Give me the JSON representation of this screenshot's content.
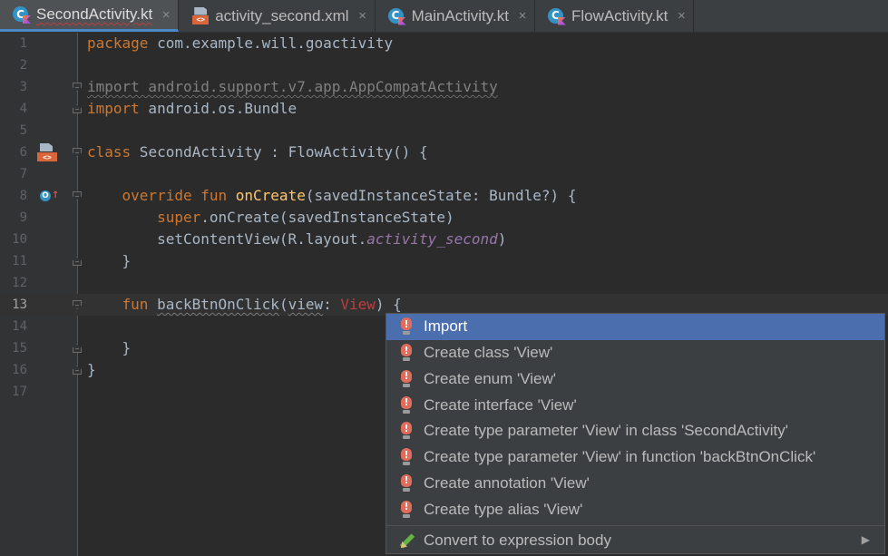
{
  "tabs": [
    {
      "label": "SecondActivity.kt",
      "icon": "kotlin-class-icon",
      "active": true
    },
    {
      "label": "activity_second.xml",
      "icon": "xml-layout-icon",
      "active": false
    },
    {
      "label": "MainActivity.kt",
      "icon": "kotlin-class-icon",
      "active": false
    },
    {
      "label": "FlowActivity.kt",
      "icon": "kotlin-class-icon",
      "active": false
    }
  ],
  "tab_close_glyph": "×",
  "line_numbers": [
    "1",
    "2",
    "3",
    "4",
    "5",
    "6",
    "7",
    "8",
    "9",
    "10",
    "11",
    "12",
    "13",
    "14",
    "15",
    "16",
    "17"
  ],
  "code": {
    "l1_kw": "package",
    "l1_rest": " com.example.will.goactivity",
    "l3": "import android.support.v7.app.AppCompatActivity",
    "l4_kw": "import",
    "l4_rest": " android.os.Bundle",
    "l6_kw": "class",
    "l6_rest": " SecondActivity : FlowActivity() {",
    "l8_kw": "override fun",
    "l8_fn": "onCreate",
    "l8_rest": "(savedInstanceState: Bundle?) {",
    "l9_kw": "super",
    "l9_rest": ".onCreate(savedInstanceState)",
    "l10_a": "setContentView(R.layout.",
    "l10_field": "activity_second",
    "l10_b": ")",
    "l11": "}",
    "l13_kw": "fun",
    "l13_fn": "backBtnOnClick",
    "l13_p1": "(",
    "l13_param": "view",
    "l13_p2": ": ",
    "l13_type": "View",
    "l13_p3": ") {",
    "l15": "}",
    "l16": "}"
  },
  "gutter_icons": {
    "xml_badge": "<>",
    "override_letter": "O",
    "override_arrow": "↑"
  },
  "popup": {
    "items": [
      "Import",
      "Create class 'View'",
      "Create enum 'View'",
      "Create interface 'View'",
      "Create type parameter 'View' in class 'SecondActivity'",
      "Create type parameter 'View' in function 'backBtnOnClick'",
      "Create annotation 'View'",
      "Create type alias 'View'"
    ],
    "selected_index": 0,
    "bulb_mark": "!",
    "convert_label": "Convert to expression body",
    "submenu_arrow": "▶"
  },
  "colors": {
    "background": "#2b2b2b",
    "keyword": "#cc7832",
    "function": "#ffc66d",
    "field": "#9876aa",
    "error": "#bc3f3c",
    "selection": "#4b6eaf"
  }
}
